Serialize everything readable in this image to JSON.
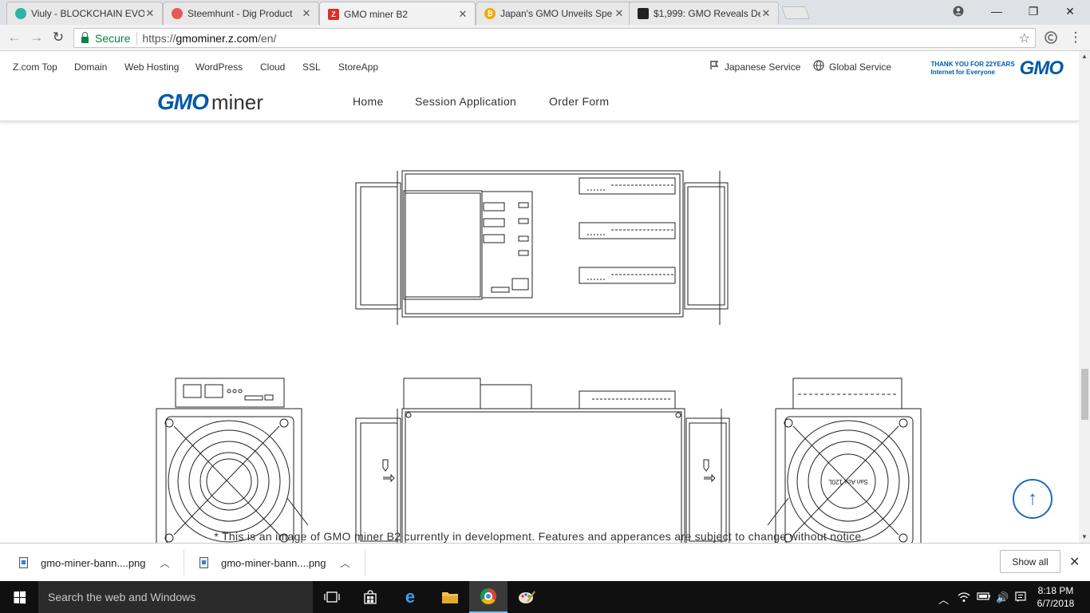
{
  "browser": {
    "tabs": [
      {
        "title": "Viuly - BLOCKCHAIN EVO",
        "favicon_color": "#2bb5a5"
      },
      {
        "title": "Steemhunt - Dig Product",
        "favicon_color": "#e55b5b"
      },
      {
        "title": "GMO miner B2",
        "favicon_color": "#d8302b",
        "active": true
      },
      {
        "title": "Japan's GMO Unveils Spe",
        "favicon_color": "#f2a900"
      },
      {
        "title": "$1,999: GMO Reveals Det",
        "favicon_color": "#222222"
      }
    ],
    "secure_label": "Secure",
    "url_prefix": "https://",
    "url_host": "gmominer.z.com",
    "url_path": "/en/"
  },
  "gmo_bar": {
    "links": [
      "Z.com Top",
      "Domain",
      "Web Hosting",
      "WordPress",
      "Cloud",
      "SSL",
      "StoreApp"
    ],
    "japanese_service": "Japanese Service",
    "global_service": "Global Service",
    "thanks_line1": "THANK YOU FOR 22YEARS",
    "thanks_line2": "Internet for Everyone",
    "gmo_logo": "GMO"
  },
  "site_header": {
    "brand_gmo": "GMO",
    "brand_miner": "miner",
    "menu": [
      "Home",
      "Session Application",
      "Order Form"
    ]
  },
  "content": {
    "notice": "* This is an image of GMO miner B2 currently in development. Features and apperances are subject to change without notice.",
    "fan_label": "San Ace 120L",
    "to_top_icon": "arrow-up-icon"
  },
  "downloads": {
    "items": [
      "gmo-miner-bann....png",
      "gmo-miner-bann....png"
    ],
    "show_all": "Show all"
  },
  "taskbar": {
    "search_placeholder": "Search the web and Windows",
    "time": "8:18 PM",
    "date": "6/7/2018"
  }
}
